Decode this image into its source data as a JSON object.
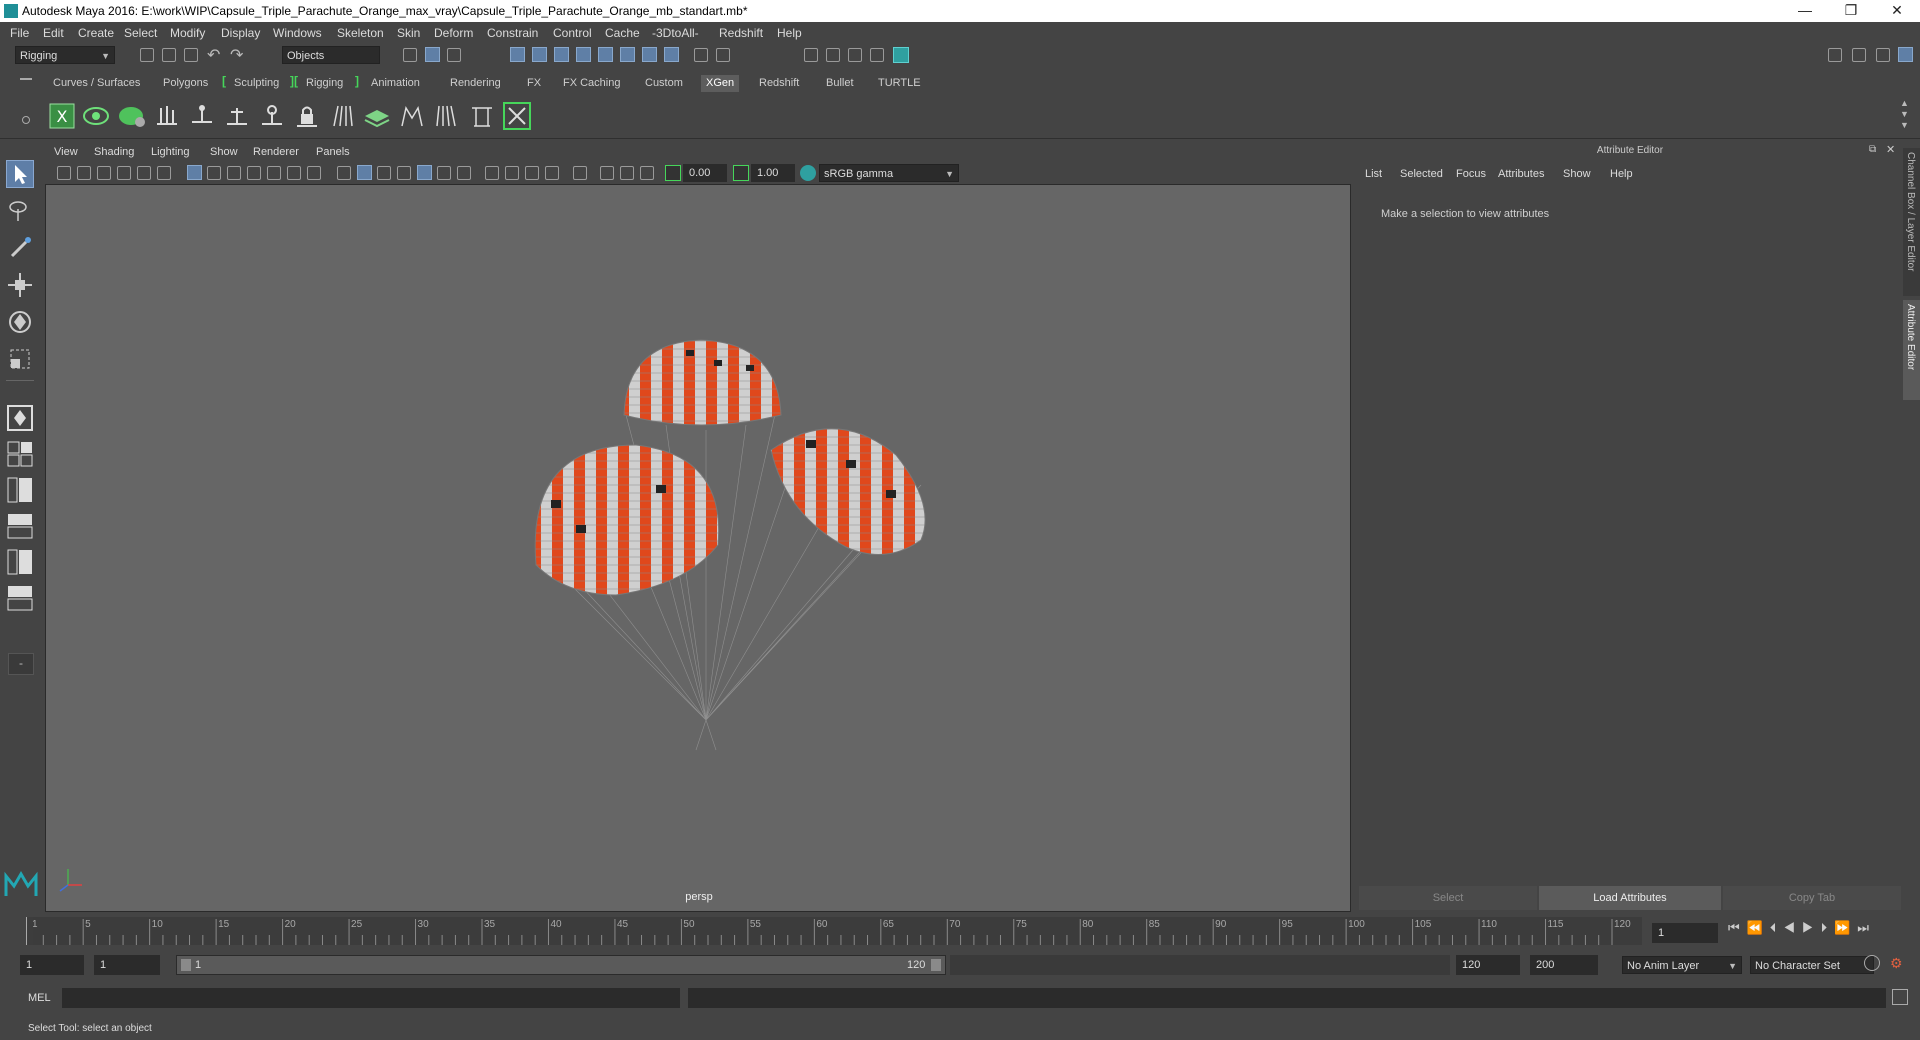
{
  "window": {
    "title": "Autodesk Maya 2016: E:\\work\\WIP\\Capsule_Triple_Parachute_Orange_max_vray\\Capsule_Triple_Parachute_Orange_mb_standart.mb*",
    "minimize": "—",
    "maximize": "❐",
    "close": "✕"
  },
  "menubar": [
    "File",
    "Edit",
    "Create",
    "Select",
    "Modify",
    "Display",
    "Windows",
    "Skeleton",
    "Skin",
    "Deform",
    "Constrain",
    "Control",
    "Cache",
    "-3DtoAll-",
    "Redshift",
    "Help"
  ],
  "statusline": {
    "menuset": "Rigging",
    "selection_mode": "Objects"
  },
  "shelf_tabs": [
    "Curves / Surfaces",
    "Polygons",
    "Sculpting",
    "Rigging",
    "Animation",
    "Rendering",
    "FX",
    "FX Caching",
    "Custom",
    "XGen",
    "Redshift",
    "Bullet",
    "TURTLE"
  ],
  "shelf_active": "XGen",
  "viewport": {
    "menu": [
      "View",
      "Shading",
      "Lighting",
      "Show",
      "Renderer",
      "Panels"
    ],
    "exposure": "0.00",
    "gamma": "1.00",
    "colorspace": "sRGB gamma",
    "camera": "persp"
  },
  "attribute_editor": {
    "title": "Attribute Editor",
    "menu": [
      "List",
      "Selected",
      "Focus",
      "Attributes",
      "Show",
      "Help"
    ],
    "message": "Make a selection to view attributes",
    "buttons": [
      "Select",
      "Load Attributes",
      "Copy Tab"
    ]
  },
  "side_tabs": [
    "Channel Box / Layer Editor",
    "Attribute Editor"
  ],
  "timeline": {
    "ticks": [
      "1",
      "5",
      "10",
      "15",
      "20",
      "25",
      "30",
      "35",
      "40",
      "45",
      "50",
      "55",
      "60",
      "65",
      "70",
      "75",
      "80",
      "85",
      "90",
      "95",
      "100",
      "105",
      "110",
      "115",
      "120"
    ],
    "current_frame": "1"
  },
  "range": {
    "start": "1",
    "playback_start": "1",
    "slider_start": "1",
    "slider_end": "120",
    "playback_end": "120",
    "end": "200",
    "anim_layer": "No Anim Layer",
    "character_set": "No Character Set"
  },
  "mel": {
    "label": "MEL"
  },
  "status": {
    "help": "Select Tool: select an object"
  },
  "colors": {
    "accent_active": "#46d65a",
    "viewport_bg": "#666666",
    "parachute_orange": "#e0481c"
  }
}
